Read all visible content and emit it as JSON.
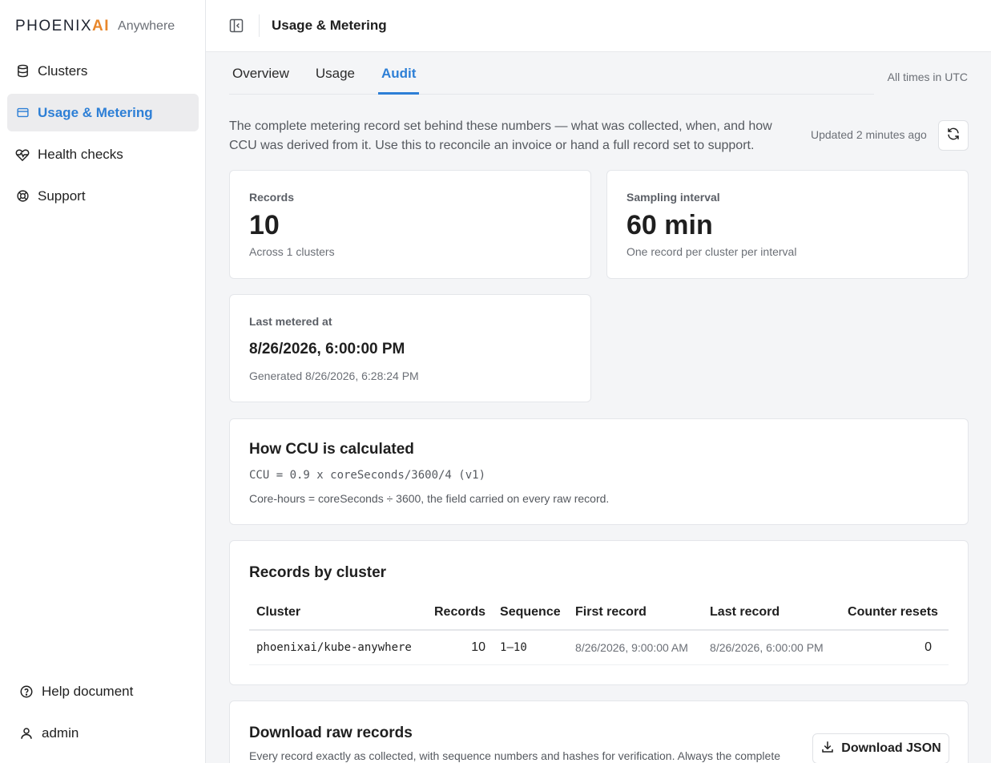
{
  "brand": {
    "logo_main": "PHOENIX",
    "logo_ai": "AI",
    "product": "Anywhere"
  },
  "sidebar": {
    "items": [
      {
        "label": "Clusters",
        "icon": "database-icon",
        "active": false
      },
      {
        "label": "Usage & Metering",
        "icon": "card-icon",
        "active": true
      },
      {
        "label": "Health checks",
        "icon": "heart-pulse-icon",
        "active": false
      },
      {
        "label": "Support",
        "icon": "lifebuoy-icon",
        "active": false
      }
    ],
    "bottom": [
      {
        "label": "Help document",
        "icon": "help-circle-icon"
      },
      {
        "label": "admin",
        "icon": "user-icon"
      }
    ]
  },
  "header": {
    "title": "Usage & Metering"
  },
  "tabs": [
    {
      "label": "Overview",
      "active": false
    },
    {
      "label": "Usage",
      "active": false
    },
    {
      "label": "Audit",
      "active": true
    }
  ],
  "timezone_note": "All times in UTC",
  "intro": {
    "text": "The complete metering record set behind these numbers — what was collected, when, and how CCU was derived from it. Use this to reconcile an invoice or hand a full record set to support.",
    "updated": "Updated 2 minutes ago"
  },
  "stats": {
    "records": {
      "label": "Records",
      "value": "10",
      "sub": "Across 1 clusters"
    },
    "sampling": {
      "label": "Sampling interval",
      "value": "60 min",
      "sub": "One record per cluster per interval"
    },
    "last_metered": {
      "label": "Last metered at",
      "value": "8/26/2026, 6:00:00 PM",
      "sub": "Generated 8/26/2026, 6:28:24 PM"
    }
  },
  "ccu": {
    "title": "How CCU is calculated",
    "formula": "CCU = 0.9 x coreSeconds/3600/4 (v1)",
    "note": "Core-hours = coreSeconds ÷ 3600, the field carried on every raw record."
  },
  "records_by_cluster": {
    "title": "Records by cluster",
    "columns": [
      "Cluster",
      "Records",
      "Sequence",
      "First record",
      "Last record",
      "Counter resets"
    ],
    "rows": [
      {
        "cluster": "phoenixai/kube-anywhere",
        "records": "10",
        "sequence": "1–10",
        "first": "8/26/2026, 9:00:00 AM",
        "last": "8/26/2026, 6:00:00 PM",
        "resets": "0"
      }
    ]
  },
  "download": {
    "title": "Download raw records",
    "desc": "Every record exactly as collected, with sequence numbers and hashes for verification. Always the complete",
    "button": "Download JSON"
  },
  "colors": {
    "accent": "#2d7fd6",
    "brand_ai": "#e8872b",
    "active_bg": "#ececee"
  }
}
